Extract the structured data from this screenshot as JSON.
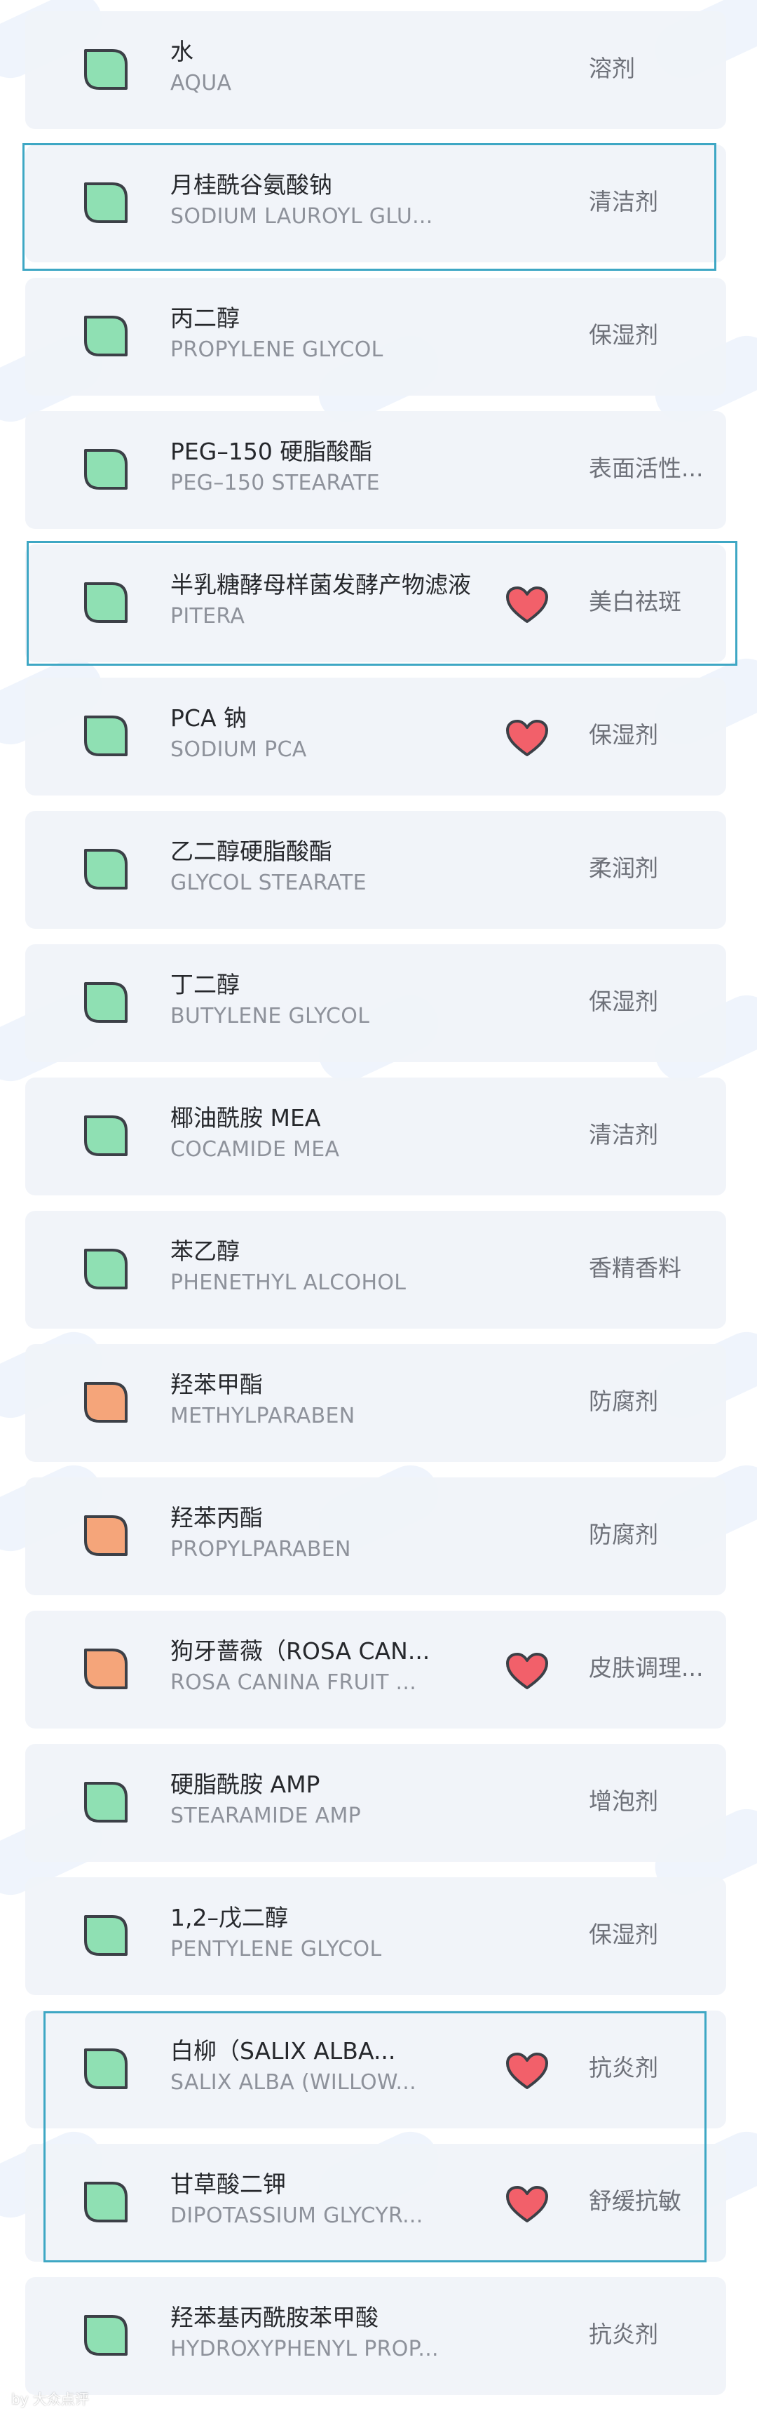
{
  "ingredients": [
    {
      "cn": "水",
      "en": "AQUA",
      "func": "溶剂",
      "icon": "leaf-green",
      "heart": false
    },
    {
      "cn": "月桂酰谷氨酸钠",
      "en": "SODIUM LAUROYL GLU...",
      "func": "清洁剂",
      "icon": "leaf-green",
      "heart": false
    },
    {
      "cn": "丙二醇",
      "en": "PROPYLENE GLYCOL",
      "func": "保湿剂",
      "icon": "leaf-green",
      "heart": false
    },
    {
      "cn": "PEG–150 硬脂酸酯",
      "en": "PEG–150 STEARATE",
      "func": "表面活性...",
      "icon": "leaf-green",
      "heart": false
    },
    {
      "cn": "半乳糖酵母样菌发酵产物滤液",
      "en": "PITERA",
      "func": "美白祛斑",
      "icon": "leaf-green",
      "heart": true
    },
    {
      "cn": "PCA 钠",
      "en": "SODIUM PCA",
      "func": "保湿剂",
      "icon": "leaf-green",
      "heart": true
    },
    {
      "cn": "乙二醇硬脂酸酯",
      "en": "GLYCOL STEARATE",
      "func": "柔润剂",
      "icon": "leaf-green",
      "heart": false
    },
    {
      "cn": "丁二醇",
      "en": "BUTYLENE GLYCOL",
      "func": "保湿剂",
      "icon": "leaf-green",
      "heart": false
    },
    {
      "cn": "椰油酰胺 MEA",
      "en": "COCAMIDE MEA",
      "func": "清洁剂",
      "icon": "leaf-green",
      "heart": false
    },
    {
      "cn": "苯乙醇",
      "en": "PHENETHYL ALCOHOL",
      "func": "香精香料",
      "icon": "leaf-green",
      "heart": false
    },
    {
      "cn": "羟苯甲酯",
      "en": "METHYLPARABEN",
      "func": "防腐剂",
      "icon": "leaf-orange",
      "heart": false
    },
    {
      "cn": "羟苯丙酯",
      "en": "PROPYLPARABEN",
      "func": "防腐剂",
      "icon": "leaf-orange",
      "heart": false
    },
    {
      "cn": "狗牙蔷薇（ROSA CAN...",
      "en": "ROSA CANINA FRUIT ...",
      "func": "皮肤调理...",
      "icon": "leaf-orange",
      "heart": true
    },
    {
      "cn": "硬脂酰胺 AMP",
      "en": "STEARAMIDE AMP",
      "func": "增泡剂",
      "icon": "leaf-green",
      "heart": false
    },
    {
      "cn": "1,2–戊二醇",
      "en": "PENTYLENE GLYCOL",
      "func": "保湿剂",
      "icon": "leaf-green",
      "heart": false
    },
    {
      "cn": "白柳（SALIX ALBA...",
      "en": "SALIX ALBA (WILLOW...",
      "func": "抗炎剂",
      "icon": "leaf-green",
      "heart": true
    },
    {
      "cn": "甘草酸二钾",
      "en": "DIPOTASSIUM GLYCYR...",
      "func": "舒缓抗敏",
      "icon": "leaf-green",
      "heart": true
    },
    {
      "cn": "羟苯基丙酰胺苯甲酸",
      "en": "HYDROXYPHENYL PROP...",
      "func": "抗炎剂",
      "icon": "leaf-green",
      "heart": false
    }
  ],
  "colors": {
    "leaf_green": "#8fe0b3",
    "leaf_orange": "#f5a57a",
    "leaf_outline": "#3c4047",
    "heart_fill": "#f2606a",
    "heart_outline": "#3c4047",
    "highlight_border": "#3ea7c4",
    "card_bg": "#f0f3f9"
  },
  "watermark": "by 大众点评"
}
